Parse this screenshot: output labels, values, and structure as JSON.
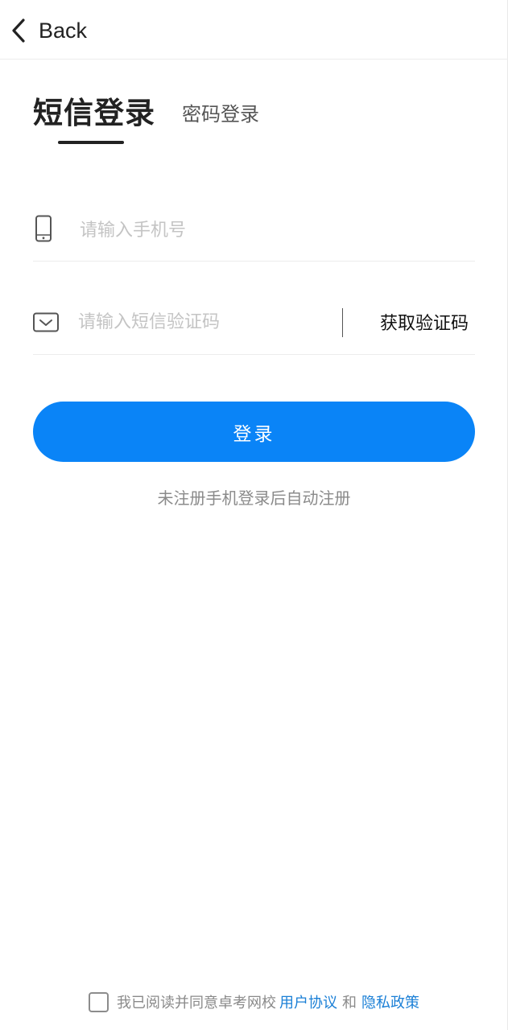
{
  "header": {
    "back_label": "Back"
  },
  "tabs": {
    "sms_login": "短信登录",
    "password_login": "密码登录"
  },
  "phone": {
    "placeholder": "请输入手机号"
  },
  "sms_code": {
    "placeholder": "请输入短信验证码",
    "get_code_label": "获取验证码"
  },
  "login_button": {
    "label": "登录"
  },
  "hint": "未注册手机登录后自动注册",
  "agreement": {
    "prefix": "我已阅读并同意卓考网校",
    "user_agreement": "用户协议",
    "and": "和",
    "privacy_policy": "隐私政策",
    "checked": false
  },
  "colors": {
    "accent": "#0a84f7",
    "link": "#1a7fd6",
    "text_primary": "#222222",
    "text_muted": "#8a8a8a",
    "placeholder": "#c4c4c4"
  },
  "icons": {
    "back": "chevron-left-icon",
    "phone": "phone-icon",
    "sms": "envelope-icon"
  }
}
